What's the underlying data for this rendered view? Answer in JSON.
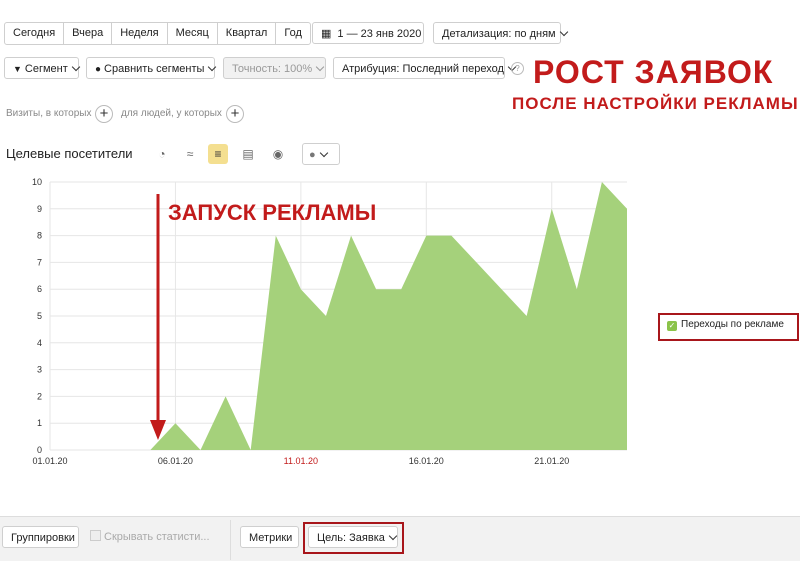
{
  "periods": [
    "Сегодня",
    "Вчера",
    "Неделя",
    "Месяц",
    "Квартал",
    "Год"
  ],
  "date_range": "1 — 23 янв 2020",
  "detail": "Детализация: по дням",
  "toolbar2": {
    "segment": "Сегмент",
    "compare": "Сравнить сегменты",
    "accuracy": "Точность: 100%",
    "attribution": "Атрибуция: Последний переход"
  },
  "filters": {
    "visits": "Визиты, в которых",
    "people": "для людей, у которых"
  },
  "chart_title": "Целевые посетители",
  "overlay": {
    "headline": "РОСТ ЗАЯВОК",
    "subline": "ПОСЛЕ НАСТРОЙКИ РЕКЛАМЫ",
    "launch": "ЗАПУСК РЕКЛАМЫ"
  },
  "legend_label": "Переходы по рекламе",
  "bottom": {
    "grouping": "Группировки",
    "hide_stats": "Скрывать статисти...",
    "metrics": "Метрики",
    "goal": "Цель: Заявка"
  },
  "colors": {
    "area": "#a5d17b",
    "accent": "#c21b1b",
    "active_icon_bg": "#f4df90"
  },
  "icons": [
    "pie-chart-icon",
    "line-chart-icon",
    "area-chart-icon",
    "bar-chart-icon",
    "map-pin-icon",
    "comment-icon"
  ],
  "chart_data": {
    "type": "area",
    "x": [
      "01.01.20",
      "02.01.20",
      "03.01.20",
      "04.01.20",
      "05.01.20",
      "06.01.20",
      "07.01.20",
      "08.01.20",
      "09.01.20",
      "10.01.20",
      "11.01.20",
      "12.01.20",
      "13.01.20",
      "14.01.20",
      "15.01.20",
      "16.01.20",
      "17.01.20",
      "18.01.20",
      "19.01.20",
      "20.01.20",
      "21.01.20",
      "22.01.20",
      "23.01.20"
    ],
    "values": [
      0,
      0,
      0,
      0,
      0,
      1,
      0,
      2,
      0,
      8,
      6,
      5,
      8,
      6,
      6,
      8,
      8,
      7,
      6,
      5,
      9,
      6,
      10,
      9
    ],
    "x_ticks": [
      "01.01.20",
      "06.01.20",
      "11.01.20",
      "16.01.20",
      "21.01.20"
    ],
    "highlight_tick": "11.01.20",
    "y_ticks": [
      0,
      1,
      2,
      3,
      4,
      5,
      6,
      7,
      8,
      9,
      10
    ],
    "ylim": [
      0,
      10
    ],
    "series": [
      {
        "name": "Переходы по рекламе"
      }
    ],
    "grid": true,
    "legend": "right"
  }
}
